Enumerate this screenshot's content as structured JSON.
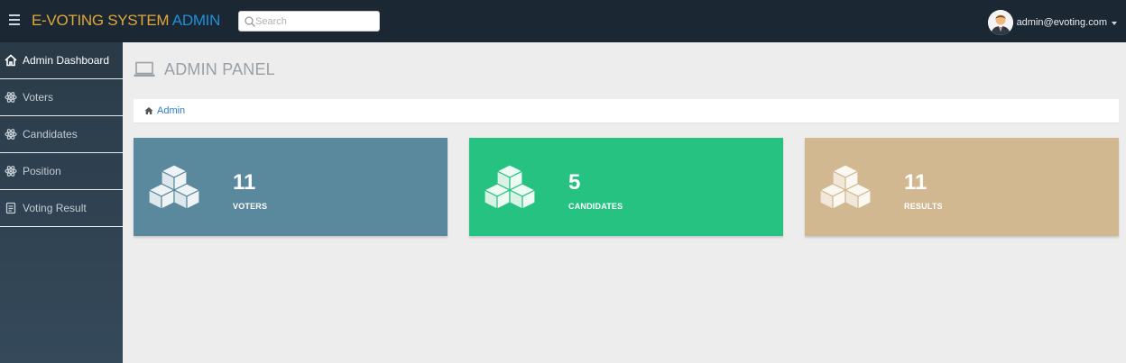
{
  "header": {
    "brand_part1": "E-VOTING SYSTEM",
    "brand_part2": "ADMIN",
    "search_placeholder": "Search",
    "user_email": "admin@evoting.com",
    "icons": {
      "menu": "hamburger-icon",
      "search": "search-icon",
      "caret": "caret-down-icon"
    }
  },
  "sidebar": {
    "items": [
      {
        "label": "Admin Dashboard",
        "icon": "home-icon",
        "active": true
      },
      {
        "label": "Voters",
        "icon": "atom-icon"
      },
      {
        "label": "Candidates",
        "icon": "atom-icon"
      },
      {
        "label": "Position",
        "icon": "atom-icon"
      },
      {
        "label": "Voting Result",
        "icon": "document-icon"
      }
    ]
  },
  "main": {
    "title": "ADMIN PANEL",
    "title_icon": "laptop-icon",
    "breadcrumb": {
      "label": "Admin",
      "icon": "home-icon"
    },
    "cards": [
      {
        "count": "11",
        "label": "VOTERS",
        "color": "#5a889c",
        "icon": "cubes-icon"
      },
      {
        "count": "5",
        "label": "CANDIDATES",
        "color": "#26c281",
        "icon": "cubes-icon"
      },
      {
        "count": "11",
        "label": "RESULTS",
        "color": "#d1b891",
        "icon": "cubes-icon"
      }
    ]
  },
  "colors": {
    "topbar": "#1b2733",
    "sidebar": "#2f4250",
    "background": "#ededed",
    "link": "#2b7dc2"
  }
}
